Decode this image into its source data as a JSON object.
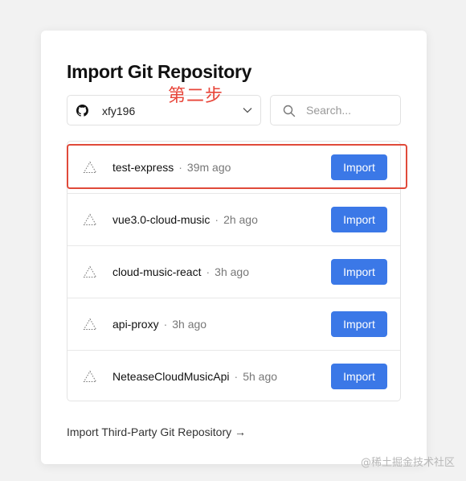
{
  "page": {
    "title": "Import Git Repository",
    "third_party_link": "Import Third-Party Git Repository →",
    "annotation": "第二步",
    "watermark": "@稀土掘金技术社区"
  },
  "account": {
    "icon": "github-icon",
    "name": "xfy196"
  },
  "search": {
    "placeholder": "Search...",
    "value": ""
  },
  "repositories": [
    {
      "name": "test-express",
      "separator": "·",
      "time": "39m ago",
      "button": "Import"
    },
    {
      "name": "vue3.0-cloud-music",
      "separator": "·",
      "time": "2h ago",
      "button": "Import"
    },
    {
      "name": "cloud-music-react",
      "separator": "·",
      "time": "3h ago",
      "button": "Import"
    },
    {
      "name": "api-proxy",
      "separator": "·",
      "time": "3h ago",
      "button": "Import"
    },
    {
      "name": "NeteaseCloudMusicApi",
      "separator": "·",
      "time": "5h ago",
      "button": "Import"
    }
  ],
  "colors": {
    "accent": "#3b78e7",
    "annotation": "#e8463a"
  }
}
